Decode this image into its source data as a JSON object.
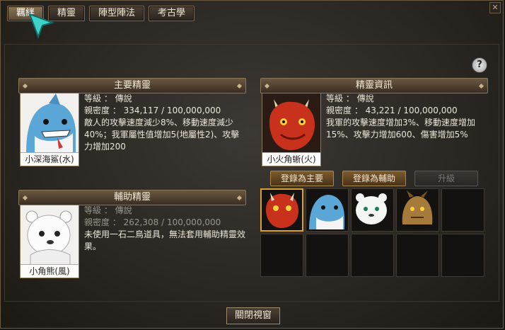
{
  "tabs": [
    "羈絆",
    "精靈",
    "陣型陣法",
    "考古學"
  ],
  "help_label": "?",
  "main_spirit": {
    "header": "主要精靈",
    "name": "小深海鯊(水)",
    "level_label": "等級",
    "level_value": "傳說",
    "intimacy_label": "親密度",
    "intimacy_value": "334,117 / 100,000,000",
    "effect": "敵人的攻擊速度減少8%、移動速度減少40%；我軍屬性值增加5(地屬性2)、攻擊力增加200"
  },
  "sub_spirit": {
    "header": "輔助精靈",
    "name": "小角熊(風)",
    "level_label": "等級",
    "level_value": "傳說",
    "intimacy_label": "親密度",
    "intimacy_value": "262,308 / 100,000,000",
    "effect": "未使用一石二鳥道具，無法套用輔助精靈效果。"
  },
  "info_spirit": {
    "header": "精靈資訊",
    "name": "小火角蜥(火)",
    "level_label": "等級",
    "level_value": "傳說",
    "intimacy_label": "親密度",
    "intimacy_value": "43,221 / 100,000,000",
    "effect": "我軍的攻擊速度增加3%、移動速度增加15%、攻擊力增加600、傷害增加5%"
  },
  "buttons": {
    "set_main": "登錄為主要",
    "set_sub": "登錄為輔助",
    "upgrade": "升級",
    "close": "關閉視窗"
  },
  "grid_icons": [
    "fire-lizard-icon",
    "deep-sea-shark-icon",
    "horned-bear-icon",
    "earth-dragon-icon"
  ],
  "colors": {
    "accent": "#d8a030",
    "panel": "#6a5740",
    "fire": "#c8321c",
    "water": "#5aa6d6"
  }
}
